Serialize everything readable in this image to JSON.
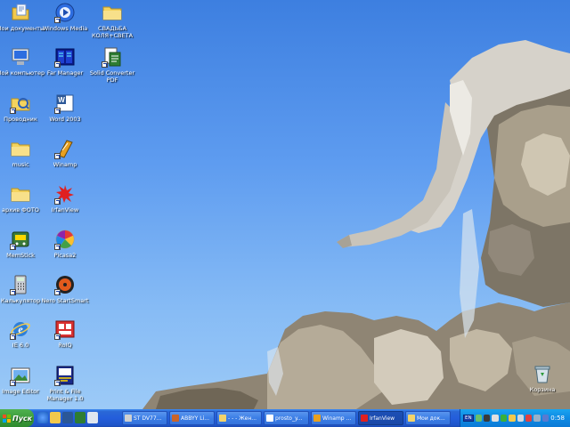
{
  "desktop": {
    "icons": [
      {
        "label": "Мои документы",
        "icon": "my-documents-icon",
        "shortcut": false
      },
      {
        "label": "Windows Media",
        "icon": "windows-media-icon",
        "shortcut": true
      },
      {
        "label": "СВАДЬБА КОЛЯ+СВЕТА",
        "icon": "folder-icon",
        "shortcut": false
      },
      {
        "label": "Мой компьютер",
        "icon": "my-computer-icon",
        "shortcut": false
      },
      {
        "label": "Far Manager",
        "icon": "far-manager-icon",
        "shortcut": true
      },
      {
        "label": "Solid Converter PDF",
        "icon": "solid-converter-icon",
        "shortcut": true
      },
      {
        "label": "Проводник",
        "icon": "explorer-icon",
        "shortcut": true
      },
      {
        "label": "Word 2003",
        "icon": "word-icon",
        "shortcut": true
      },
      {
        "label": "music",
        "icon": "folder-icon",
        "shortcut": false
      },
      {
        "label": "Winamp",
        "icon": "winamp-icon",
        "shortcut": true
      },
      {
        "label": "архив ФОТО",
        "icon": "folder-icon",
        "shortcut": false
      },
      {
        "label": "IrfanView",
        "icon": "irfanview-icon",
        "shortcut": true
      },
      {
        "label": "MemStick",
        "icon": "memstick-icon",
        "shortcut": true
      },
      {
        "label": "Picasa2",
        "icon": "picasa-icon",
        "shortcut": true
      },
      {
        "label": "Калькулятор",
        "icon": "calculator-icon",
        "shortcut": true
      },
      {
        "label": "Nero StartSmart",
        "icon": "nero-icon",
        "shortcut": true
      },
      {
        "label": "IE 6.0",
        "icon": "ie-icon",
        "shortcut": true
      },
      {
        "label": "RoIQ",
        "icon": "roiq-icon",
        "shortcut": true
      },
      {
        "label": "Image Editor",
        "icon": "image-editor-icon",
        "shortcut": true
      },
      {
        "label": "Print & File Manager 1.0",
        "icon": "print-file-manager-icon",
        "shortcut": true
      },
      {
        "label": "Корзина",
        "icon": "recycle-bin-icon",
        "shortcut": false
      }
    ]
  },
  "taskbar": {
    "start_label": "Пуск",
    "quick_launch": [
      "ie-icon",
      "outlook-icon",
      "word-icon",
      "excel-icon",
      "show-desktop-icon"
    ],
    "tasks": [
      {
        "label": "ST DV77...",
        "icon": "app-icon",
        "color": "#d0d0d0"
      },
      {
        "label": "ABBYY Li...",
        "icon": "abbyy-icon",
        "color": "#c9642a"
      },
      {
        "label": "- - - Жен...",
        "icon": "folder-icon",
        "color": "#f3d36a"
      },
      {
        "label": "prosto_y...",
        "icon": "document-icon",
        "color": "#ffffff"
      },
      {
        "label": "Winamp ...",
        "icon": "winamp-icon",
        "color": "#e8a020"
      },
      {
        "label": "IrfanView",
        "icon": "irfanview-icon",
        "color": "#e02020",
        "active": true
      },
      {
        "label": "Мои док...",
        "icon": "folder-icon",
        "color": "#f3d36a"
      }
    ],
    "tray": {
      "lang": "EN",
      "icons": [
        "network-icon",
        "antivirus-icon",
        "volume-icon",
        "messenger-icon",
        "update-icon",
        "speaker-icon",
        "shield-icon",
        "hardware-icon",
        "display-icon"
      ],
      "clock": "0:58"
    }
  }
}
